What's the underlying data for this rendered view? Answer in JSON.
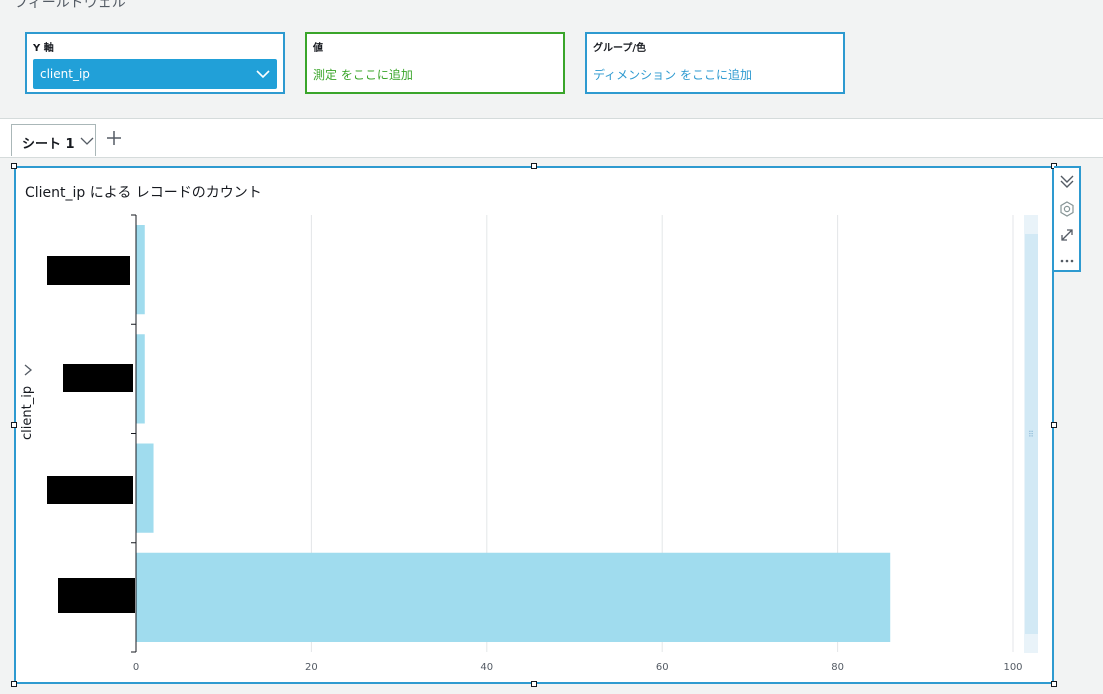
{
  "field_wells": {
    "title": "フィールドウェル",
    "y_axis": {
      "label": "Y 軸",
      "field": "client_ip"
    },
    "value": {
      "label": "値",
      "hint": "測定 をここに追加"
    },
    "group": {
      "label": "グループ/色",
      "hint": "ディメンション をここに追加"
    }
  },
  "sheet_tabs": [
    {
      "label": "シート 1"
    }
  ],
  "visual": {
    "title": "Client_ip による レコードのカウント",
    "y_axis_title": "client_ip"
  },
  "colors": {
    "accent": "#2e9ad0",
    "bar": "#a0dcee",
    "value_well": "#3aa52a"
  },
  "icons": [
    "chevron-down-icon",
    "plus-icon",
    "collapse-icon",
    "gear-icon",
    "expand-icon",
    "more-icon",
    "chevron-right-icon"
  ],
  "chart_data": {
    "type": "bar",
    "orientation": "horizontal",
    "title": "Client_ip による レコードのカウント",
    "ylabel": "client_ip",
    "xlabel": "",
    "categories": [
      "",
      "",
      "",
      ""
    ],
    "category_labels_redacted": true,
    "values": [
      1,
      1,
      2,
      86
    ],
    "xlim": [
      0,
      100
    ],
    "x_ticks": [
      0,
      20,
      40,
      60,
      80,
      100
    ],
    "x_tick_labels": [
      "0",
      "20",
      "40",
      "60",
      "80",
      "100"
    ],
    "grid": true
  }
}
